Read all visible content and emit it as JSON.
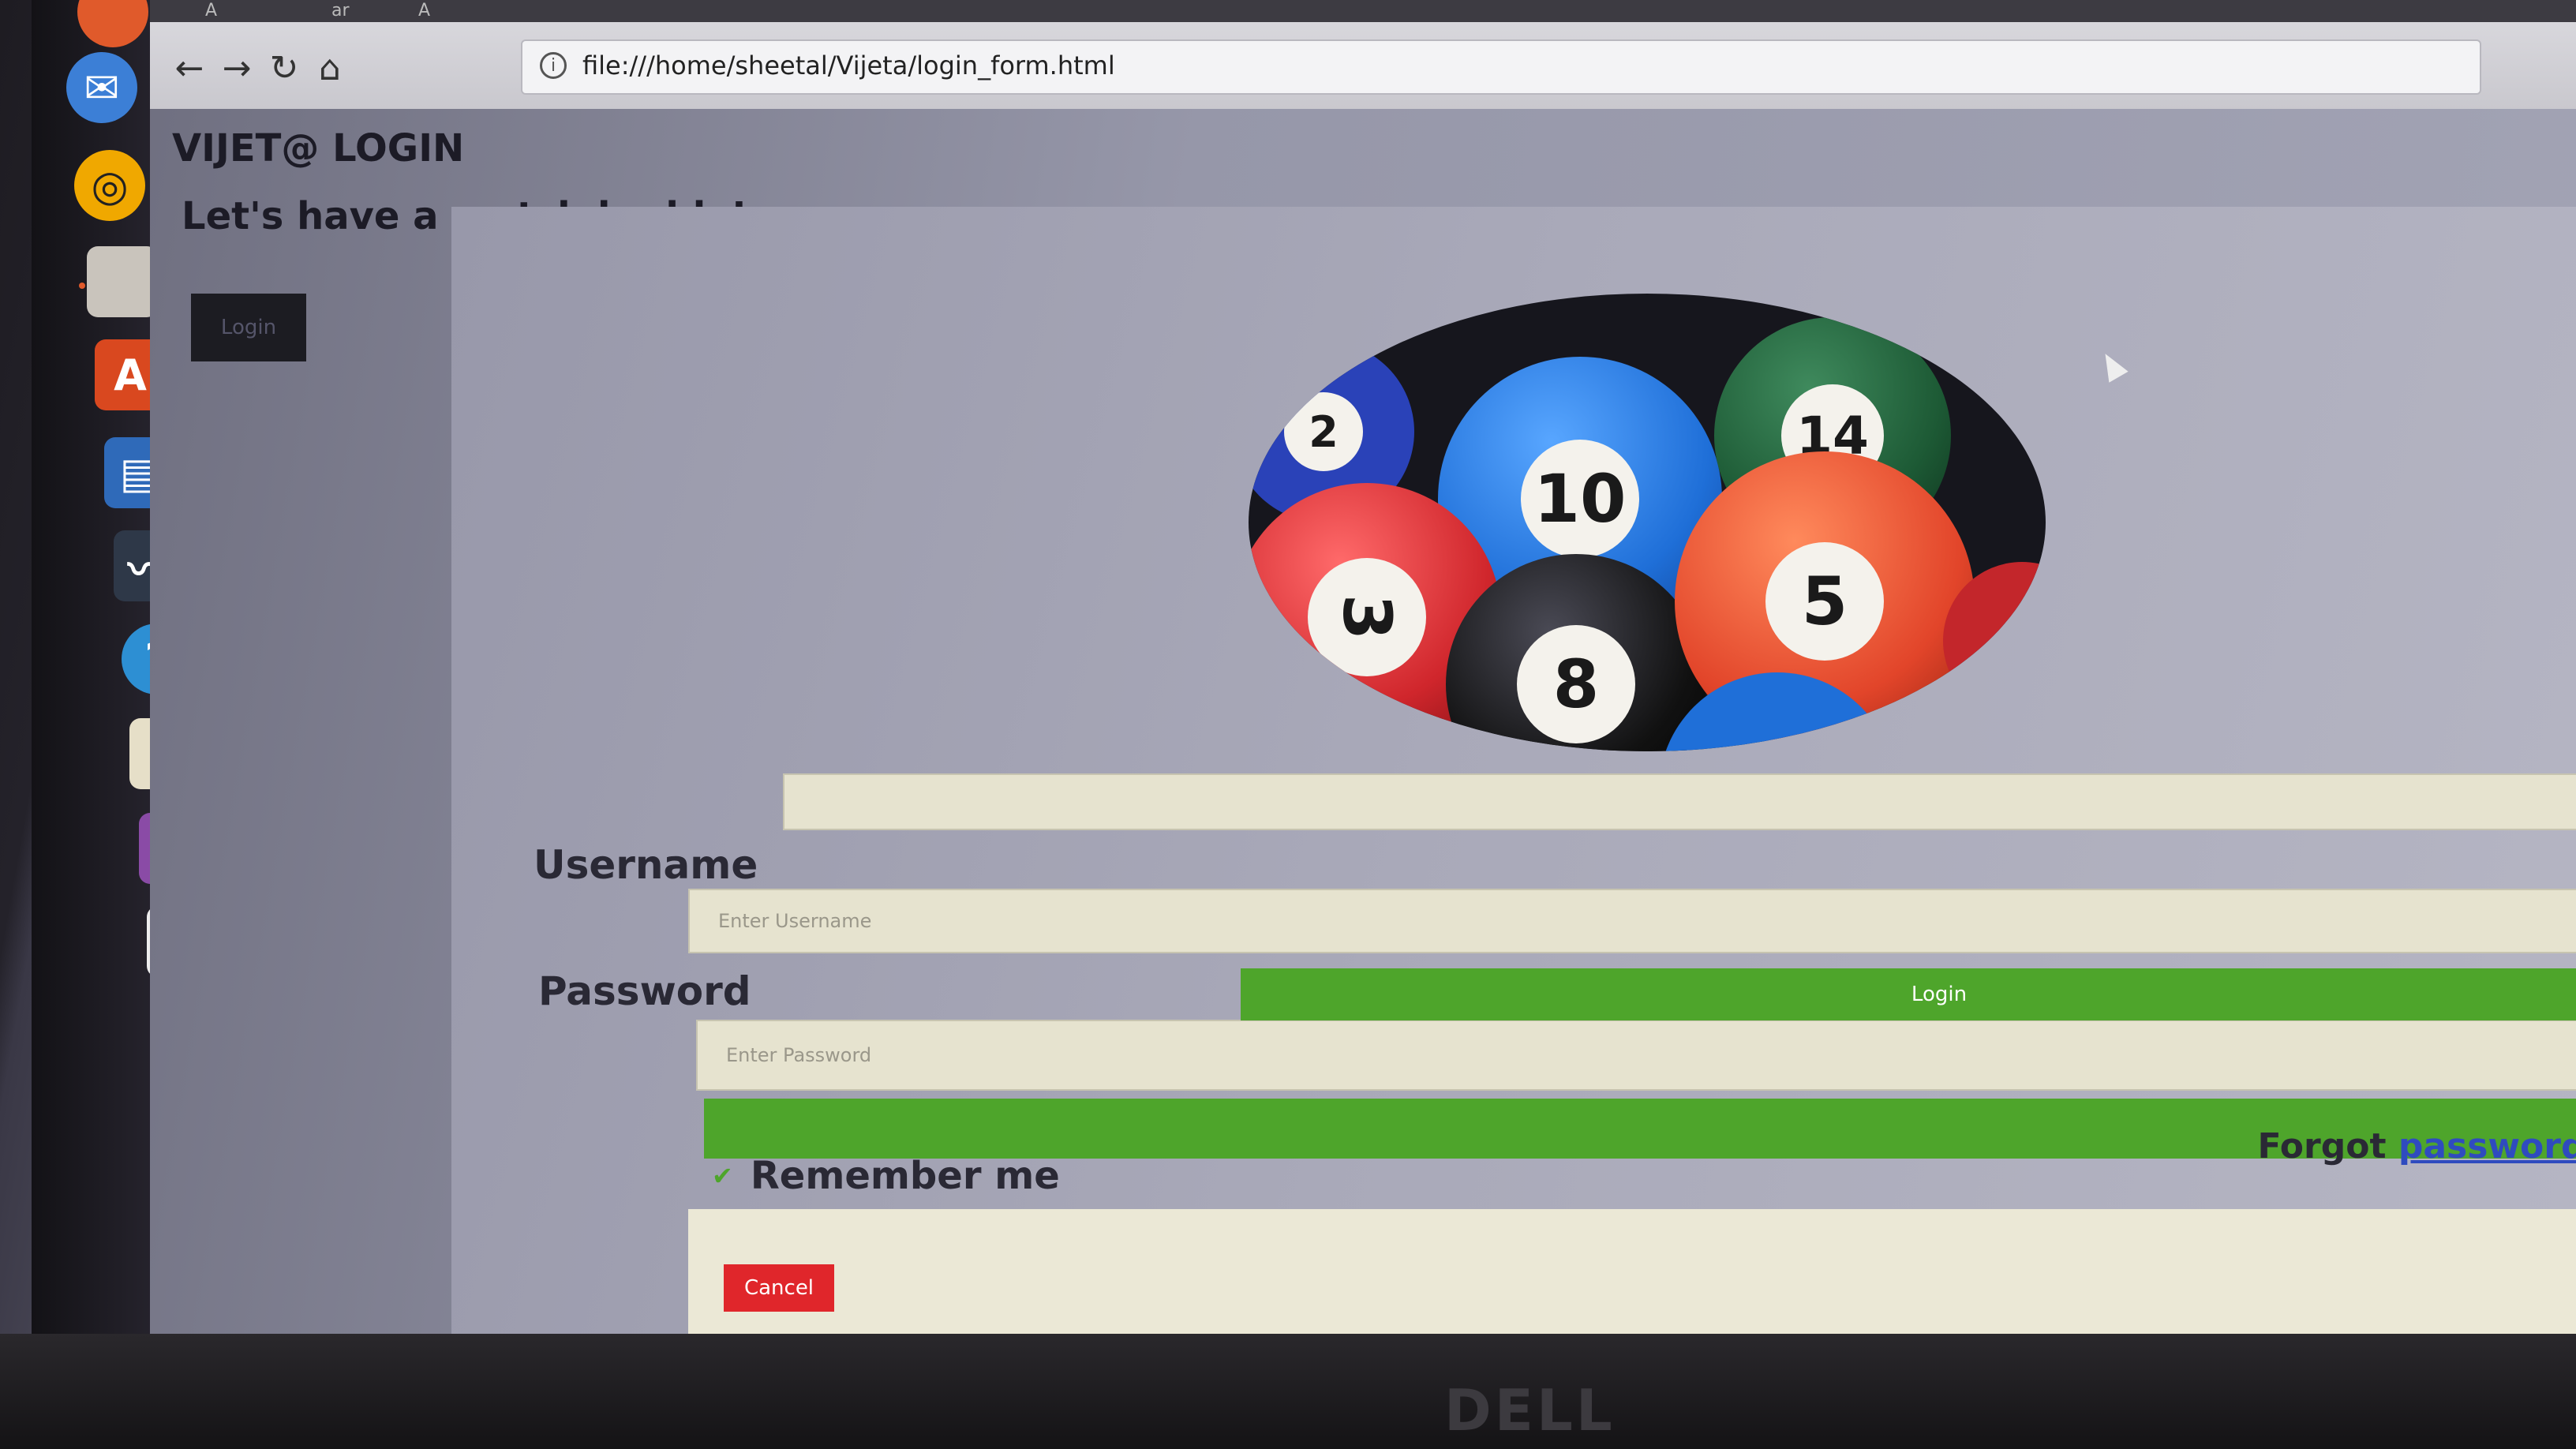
{
  "browser": {
    "tabs": [
      {
        "label": "A"
      },
      {
        "label": "ar"
      },
      {
        "label": "A"
      }
    ],
    "url": "file:///home/sheetal/Vijeta/login_form.html"
  },
  "page": {
    "title": "VIJET@ LOGIN",
    "subtitle": "Let's have a match buddy!",
    "open_login_label": "Login"
  },
  "modal": {
    "close_symbol": "×",
    "balls": [
      {
        "number": "10",
        "color": "#1f6fd8"
      },
      {
        "number": "14",
        "color": "#1d5a35"
      },
      {
        "number": "3",
        "color": "#d0262c"
      },
      {
        "number": "8",
        "color": "#111111"
      },
      {
        "number": "5",
        "color": "#e2452a"
      },
      {
        "number": "2",
        "color": "#2a42b8"
      }
    ],
    "username_label": "Username",
    "username_placeholder": "Enter Username",
    "password_label": "Password",
    "password_placeholder": "Enter Password",
    "login_button": "Login",
    "remember_label": "Remember me",
    "forgot_prefix": "Forgot",
    "forgot_link": "password?",
    "cancel_button": "Cancel"
  },
  "hardware": {
    "brand": "DELL"
  },
  "colors": {
    "login_green": "#4ea52b",
    "cancel_red": "#e0262b",
    "link_blue": "#2f4bbf"
  }
}
